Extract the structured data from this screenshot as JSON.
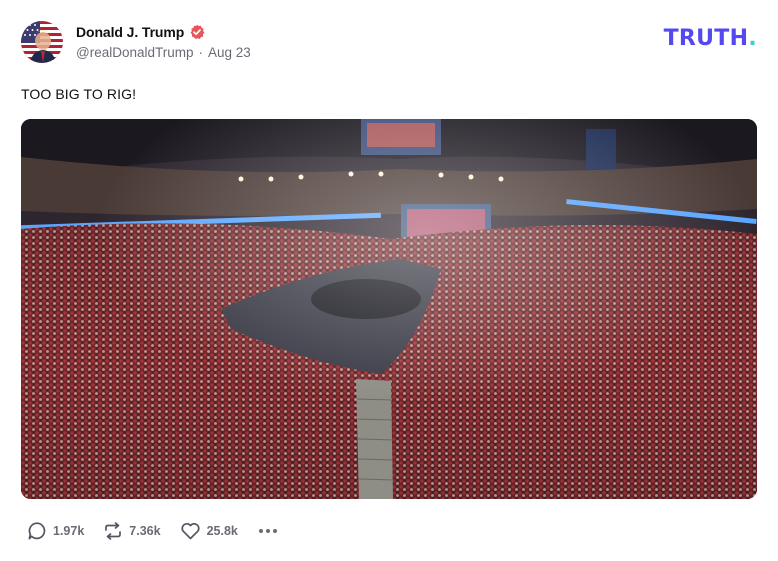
{
  "author": {
    "display_name": "Donald J. Trump",
    "handle": "@realDonaldTrump",
    "separator": "·",
    "timestamp": "Aug 23",
    "verified": true,
    "avatar_icon": "flag-portrait-avatar"
  },
  "brand": {
    "wordmark": "TRUTH",
    "wordmark_dot": ".",
    "color": "#5448ee",
    "dot_color": "#36d3c4"
  },
  "post": {
    "text": "TOO BIG TO RIG!",
    "media_icon": "arena-crowd-photo"
  },
  "actions": {
    "replies": {
      "icon": "reply-icon",
      "count": "1.97k"
    },
    "retruths": {
      "icon": "retruth-icon",
      "count": "7.36k"
    },
    "likes": {
      "icon": "heart-icon",
      "count": "25.8k"
    },
    "more": {
      "icon": "more-icon"
    }
  },
  "colors": {
    "verified_badge": "#e8565b",
    "muted_text": "#6b6b76"
  }
}
